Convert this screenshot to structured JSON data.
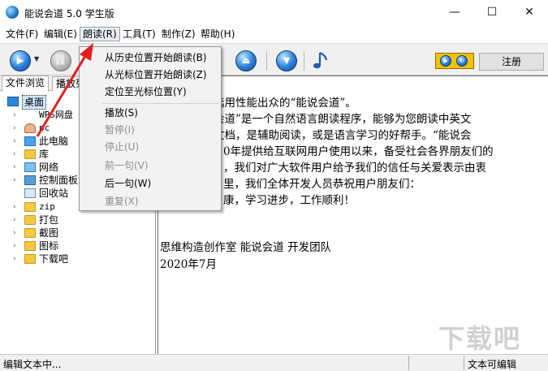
{
  "window": {
    "title": "能说会道 5.0 学生版",
    "controls": {
      "minimize": "—",
      "maximize": "☐",
      "close": "✕"
    }
  },
  "menubar": {
    "items": [
      {
        "label": "文件(F)"
      },
      {
        "label": "编辑(E)"
      },
      {
        "label": "朗读(R)"
      },
      {
        "label": "工具(T)"
      },
      {
        "label": "制作(Z)"
      },
      {
        "label": "帮助(H)"
      }
    ]
  },
  "toolbar": {
    "register_label": "注册",
    "icons": [
      "play-icon",
      "pause-icon",
      "up-icon",
      "down-icon",
      "music-note-icon",
      "speed-icon"
    ]
  },
  "read_menu": {
    "items": [
      {
        "label": "从历史位置开始朗读(B)",
        "enabled": true
      },
      {
        "label": "从光标位置开始朗读(Z)",
        "enabled": true
      },
      {
        "label": "定位至光标位置(Y)",
        "enabled": true
      },
      {
        "label": "播放(S)",
        "enabled": true
      },
      {
        "label": "暂停(I)",
        "enabled": false
      },
      {
        "label": "停止(U)",
        "enabled": false
      },
      {
        "label": "前一句(V)",
        "enabled": false
      },
      {
        "label": "后一句(W)",
        "enabled": true
      },
      {
        "label": "重复(X)",
        "enabled": false
      }
    ]
  },
  "left_panel": {
    "tabs": [
      {
        "label": "文件浏览"
      },
      {
        "label": "播放列"
      }
    ],
    "tree": [
      {
        "label": "桌面",
        "icon": "desktop-icon",
        "level": 0,
        "selected": true
      },
      {
        "label": "WPS网盘",
        "icon": "cloud-drive-icon",
        "level": 1
      },
      {
        "label": "pc",
        "icon": "user-icon",
        "level": 1
      },
      {
        "label": "此电脑",
        "icon": "computer-icon",
        "level": 1
      },
      {
        "label": "库",
        "icon": "library-icon",
        "level": 1
      },
      {
        "label": "网络",
        "icon": "network-icon",
        "level": 1
      },
      {
        "label": "控制面板",
        "icon": "control-panel-icon",
        "level": 1
      },
      {
        "label": "回收站",
        "icon": "recycle-bin-icon",
        "level": 1
      },
      {
        "label": "zip",
        "icon": "folder-icon",
        "level": 1
      },
      {
        "label": "打包",
        "icon": "folder-icon",
        "level": 1
      },
      {
        "label": "截图",
        "icon": "folder-icon",
        "level": 1
      },
      {
        "label": "图标",
        "icon": "folder-icon",
        "level": 1
      },
      {
        "label": "下载吧",
        "icon": "folder-icon",
        "level": 1
      }
    ]
  },
  "editor": {
    "lines": [
      "选用性能出众的“能说会道”。",
      "会道”是一个自然语言朗读程序，能够为您朗读中英文",
      "文档，是辅助阅读，或是语言学习的好帮手。“能说会",
      "0年提供给互联网用户使用以来，备受社会各界朋友们的",
      "，我们对广大软件用户给予我们的信任与关爱表示由衷",
      "里，我们全体开发人员恭祝用户朋友们：",
      "康，学习进步，工作顺利！",
      "",
      "",
      "思维构造创作室  能说会道  开发团队",
      "2020年7月"
    ]
  },
  "statusbar": {
    "left": "编辑文本中...",
    "right": "文本可编辑"
  },
  "watermark": "下载吧"
}
